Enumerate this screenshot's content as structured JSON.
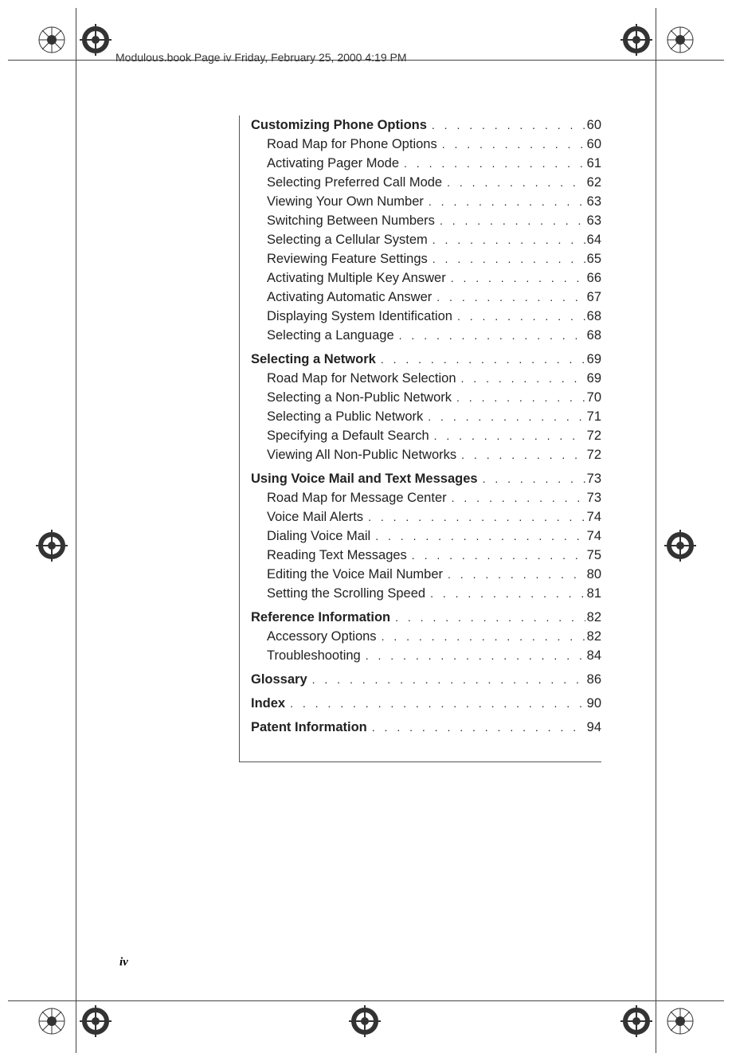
{
  "header_line": "Modulous.book  Page iv  Friday, February 25, 2000  4:19 PM",
  "page_number": "iv",
  "toc": [
    {
      "title": "Customizing Phone Options",
      "page": "60",
      "items": [
        {
          "title": "Road Map for Phone Options",
          "page": "60"
        },
        {
          "title": "Activating Pager Mode",
          "page": "61"
        },
        {
          "title": "Selecting Preferred Call Mode",
          "page": "62"
        },
        {
          "title": "Viewing Your Own Number",
          "page": "63"
        },
        {
          "title": "Switching Between Numbers",
          "page": "63"
        },
        {
          "title": "Selecting a Cellular System",
          "page": "64"
        },
        {
          "title": "Reviewing Feature Settings",
          "page": "65"
        },
        {
          "title": "Activating Multiple Key Answer",
          "page": "66"
        },
        {
          "title": "Activating Automatic Answer",
          "page": "67"
        },
        {
          "title": "Displaying System Identification",
          "page": "68"
        },
        {
          "title": "Selecting a Language",
          "page": "68"
        }
      ]
    },
    {
      "title": "Selecting a Network",
      "page": "69",
      "items": [
        {
          "title": "Road Map for Network Selection",
          "page": "69"
        },
        {
          "title": "Selecting a Non-Public Network",
          "page": "70"
        },
        {
          "title": "Selecting a Public Network",
          "page": "71"
        },
        {
          "title": "Specifying a Default Search",
          "page": "72"
        },
        {
          "title": "Viewing All Non-Public Networks",
          "page": "72"
        }
      ]
    },
    {
      "title": "Using Voice Mail and Text Messages",
      "page": "73",
      "items": [
        {
          "title": "Road Map for Message Center",
          "page": "73"
        },
        {
          "title": "Voice Mail Alerts",
          "page": "74"
        },
        {
          "title": "Dialing Voice Mail",
          "page": "74"
        },
        {
          "title": "Reading Text Messages",
          "page": "75"
        },
        {
          "title": "Editing the Voice Mail Number",
          "page": "80"
        },
        {
          "title": "Setting the Scrolling Speed",
          "page": "81"
        }
      ]
    },
    {
      "title": "Reference Information",
      "page": "82",
      "items": [
        {
          "title": "Accessory Options",
          "page": "82"
        },
        {
          "title": "Troubleshooting",
          "page": "84"
        }
      ]
    },
    {
      "title": "Glossary",
      "page": "86",
      "items": []
    },
    {
      "title": "Index",
      "page": "90",
      "items": []
    },
    {
      "title": "Patent Information",
      "page": "94",
      "items": []
    }
  ]
}
